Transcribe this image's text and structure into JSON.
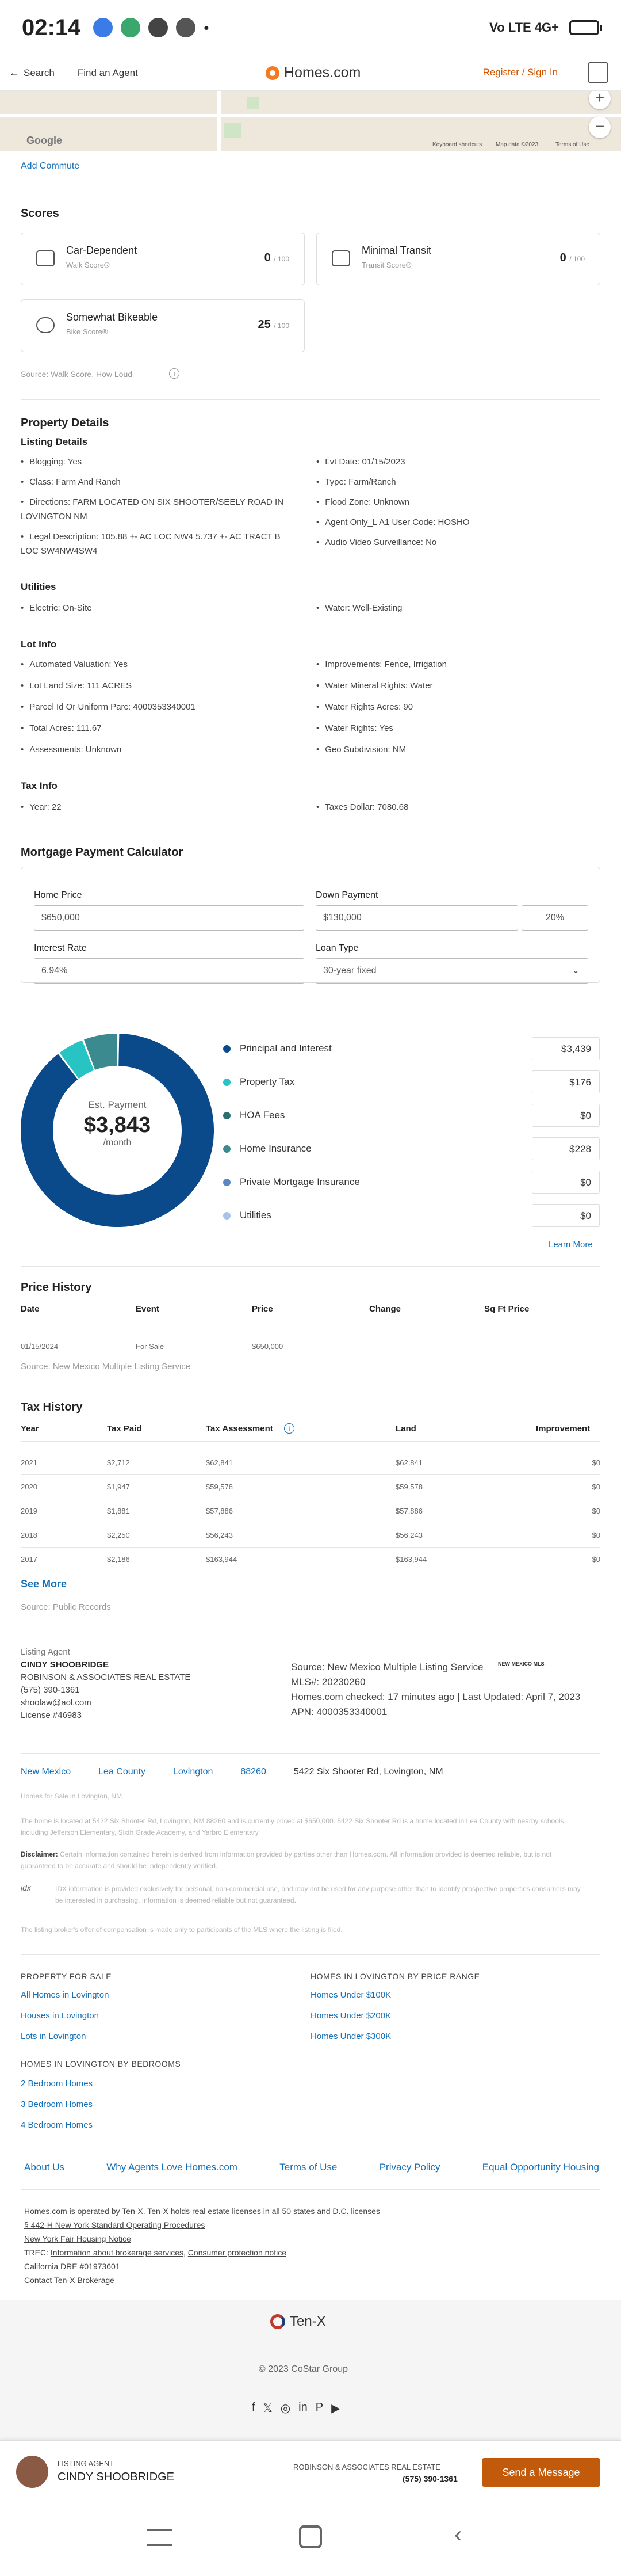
{
  "status": {
    "time": "02:14",
    "network": "Vo LTE 4G+"
  },
  "topbar": {
    "back": "Search",
    "agent": "Find an Agent",
    "logo": "Homes.com",
    "register": "Register / Sign In"
  },
  "map": {
    "google": "Google",
    "keyboard": "Keyboard shortcuts",
    "mapdata": "Map data ©2023",
    "terms": "Terms of Use"
  },
  "commute": "Add Commute",
  "scores": {
    "title": "Scores",
    "items": [
      {
        "name": "Car-Dependent",
        "sub": "Walk Score®",
        "score": "0",
        "of": "/ 100"
      },
      {
        "name": "Minimal Transit",
        "sub": "Transit Score®",
        "score": "0",
        "of": "/ 100"
      },
      {
        "name": "Somewhat Bikeable",
        "sub": "Bike Score®",
        "score": "25",
        "of": "/ 100"
      }
    ],
    "source": "Source: Walk Score, How Loud"
  },
  "details": {
    "title": "Property Details",
    "listing_title": "Listing Details",
    "listing_left": [
      "Blogging: Yes",
      "Class: Farm And Ranch",
      "Directions: FARM LOCATED ON SIX SHOOTER/SEELY ROAD IN LOVINGTON NM",
      "Legal Description: 105.88 +- AC LOC NW4 5.737 +- AC TRACT B LOC SW4NW4SW4"
    ],
    "listing_right": [
      "Lvt Date: 01/15/2023",
      "Type: Farm/Ranch",
      "Flood Zone: Unknown",
      "Agent Only_L A1 User Code: HOSHO",
      "Audio Video Surveillance: No"
    ],
    "util_title": "Utilities",
    "util_left": [
      "Electric: On-Site"
    ],
    "util_right": [
      "Water: Well-Existing"
    ],
    "lot_title": "Lot Info",
    "lot_left": [
      "Automated Valuation: Yes",
      "Lot Land Size: 111 ACRES",
      "Parcel Id Or Uniform Parc: 4000353340001",
      "Total Acres: 111.67",
      "Assessments: Unknown"
    ],
    "lot_right": [
      "Improvements: Fence, Irrigation",
      "Water Mineral Rights: Water",
      "Water Rights Acres: 90",
      "Water Rights: Yes",
      "Geo Subdivision: NM"
    ],
    "tax_title": "Tax Info",
    "tax_left": [
      "Year: 22"
    ],
    "tax_right": [
      "Taxes Dollar: 7080.68"
    ]
  },
  "mortgage": {
    "title": "Mortgage Payment Calculator",
    "home_price_label": "Home Price",
    "home_price": "$650,000",
    "down_label": "Down Payment",
    "down": "$130,000",
    "down_pct": "20%",
    "rate_label": "Interest Rate",
    "rate": "6.94%",
    "loan_label": "Loan Type",
    "loan": "30-year fixed",
    "est_label": "Est. Payment",
    "est_value": "$3,843",
    "est_unit": "/month",
    "items": [
      {
        "label": "Principal and Interest",
        "value": "$3,439",
        "amount": 3439,
        "color": "#0a4a8a"
      },
      {
        "label": "Property Tax",
        "value": "$176",
        "amount": 176,
        "color": "#28c3c3"
      },
      {
        "label": "HOA Fees",
        "value": "$0",
        "amount": 0,
        "color": "#2b6f73"
      },
      {
        "label": "Home Insurance",
        "value": "$228",
        "amount": 228,
        "color": "#3b8a8f"
      },
      {
        "label": "Private Mortgage Insurance",
        "value": "$0",
        "amount": 0,
        "color": "#5a86c4"
      },
      {
        "label": "Utilities",
        "value": "$0",
        "amount": 0,
        "color": "#a7c3ea"
      }
    ],
    "learn": "Learn More"
  },
  "price_history": {
    "title": "Price History",
    "headers": [
      "Date",
      "Event",
      "Price",
      "Change",
      "Sq Ft Price"
    ],
    "rows": [
      [
        "01/15/2024",
        "For Sale",
        "$650,000",
        "—",
        "—"
      ]
    ],
    "source": "Source: New Mexico Multiple Listing Service"
  },
  "tax_history": {
    "title": "Tax History",
    "headers": [
      "Year",
      "Tax Paid",
      "Tax Assessment",
      "Land",
      "Improvement"
    ],
    "rows": [
      [
        "2021",
        "$2,712",
        "$62,841",
        "$62,841",
        "$0"
      ],
      [
        "2020",
        "$1,947",
        "$59,578",
        "$59,578",
        "$0"
      ],
      [
        "2019",
        "$1,881",
        "$57,886",
        "$57,886",
        "$0"
      ],
      [
        "2018",
        "$2,250",
        "$56,243",
        "$56,243",
        "$0"
      ],
      [
        "2017",
        "$2,186",
        "$163,944",
        "$163,944",
        "$0"
      ]
    ],
    "see_more": "See More",
    "source": "Source: Public Records"
  },
  "agent": {
    "label": "Listing Agent",
    "name": "CINDY SHOOBRIDGE",
    "company": "ROBINSON & ASSOCIATES REAL ESTATE",
    "phone": "(575) 390-1361",
    "email": "shoolaw@aol.com",
    "license": "License #46983",
    "source": "Source: New Mexico Multiple Listing Service",
    "mls": "MLS#: 20230260",
    "checked": "Homes.com checked: 17 minutes ago | Last Updated: April 7, 2023",
    "apn": "APN: 4000353340001",
    "mls_logo": "NEW MEXICO MLS"
  },
  "breadcrumb": [
    "New Mexico",
    "Lea County",
    "Lovington",
    "88260",
    "5422 Six Shooter Rd, Lovington, NM"
  ],
  "home_for_sale": "Homes for Sale in Lovington, NM",
  "desc": "The home is located at 5422 Six Shooter Rd, Lovington, NM 88260 and is currently priced at $650,000. 5422 Six Shooter Rd is a home located in Lea County with nearby schools including Jefferson Elementary, Sixth Grade Academy, and Yarbro Elementary.",
  "disclaimer_label": "Disclaimer:",
  "disclaimer": "Certain information contained herein is derived from information provided by parties other than Homes.com. All information provided is deemed reliable, but is not guaranteed to be accurate and should be independently verified.",
  "idx": "IDX information is provided exclusively for personal, non-commercial use, and may not be used for any purpose other than to identify prospective properties consumers may be interested in purchasing. Information is deemed reliable but not guaranteed.",
  "listing_broker": "The listing broker's offer of compensation is made only to participants of the MLS where the listing is filed.",
  "footer": {
    "pfs_title": "PROPERTY FOR SALE",
    "pfs": [
      "All Homes in Lovington",
      "Houses in Lovington",
      "Lots in Lovington"
    ],
    "price_title": "HOMES IN LOVINGTON BY PRICE RANGE",
    "price": [
      "Homes Under $100K",
      "Homes Under $200K",
      "Homes Under $300K"
    ],
    "bed_title": "HOMES IN LOVINGTON BY BEDROOMS",
    "beds": [
      "2 Bedroom Homes",
      "3 Bedroom Homes",
      "4 Bedroom Homes"
    ],
    "links": [
      "About Us",
      "Why Agents Love Homes.com",
      "Terms of Use",
      "Privacy Policy",
      "Equal Opportunity Housing"
    ],
    "legal1": "Homes.com is operated by Ten-X. Ten-X holds real estate licenses in all 50 states and D.C.",
    "legal1_link": "licenses",
    "legal2": "§ 442-H New York Standard Operating Procedures",
    "legal3": "New York Fair Housing Notice",
    "legal4_pre": "TREC:",
    "legal4a": "Information about brokerage services",
    "legal4b": "Consumer protection notice",
    "legal5": "California DRE #01973601",
    "legal6": "Contact Ten-X Brokerage",
    "tenx": "Ten-X",
    "copyright": "© 2023 CoStar Group"
  },
  "sticky": {
    "label": "LISTING AGENT",
    "name": "CINDY SHOOBRIDGE",
    "company": "ROBINSON & ASSOCIATES REAL ESTATE",
    "phone": "(575) 390-1361",
    "button": "Send a Message"
  }
}
